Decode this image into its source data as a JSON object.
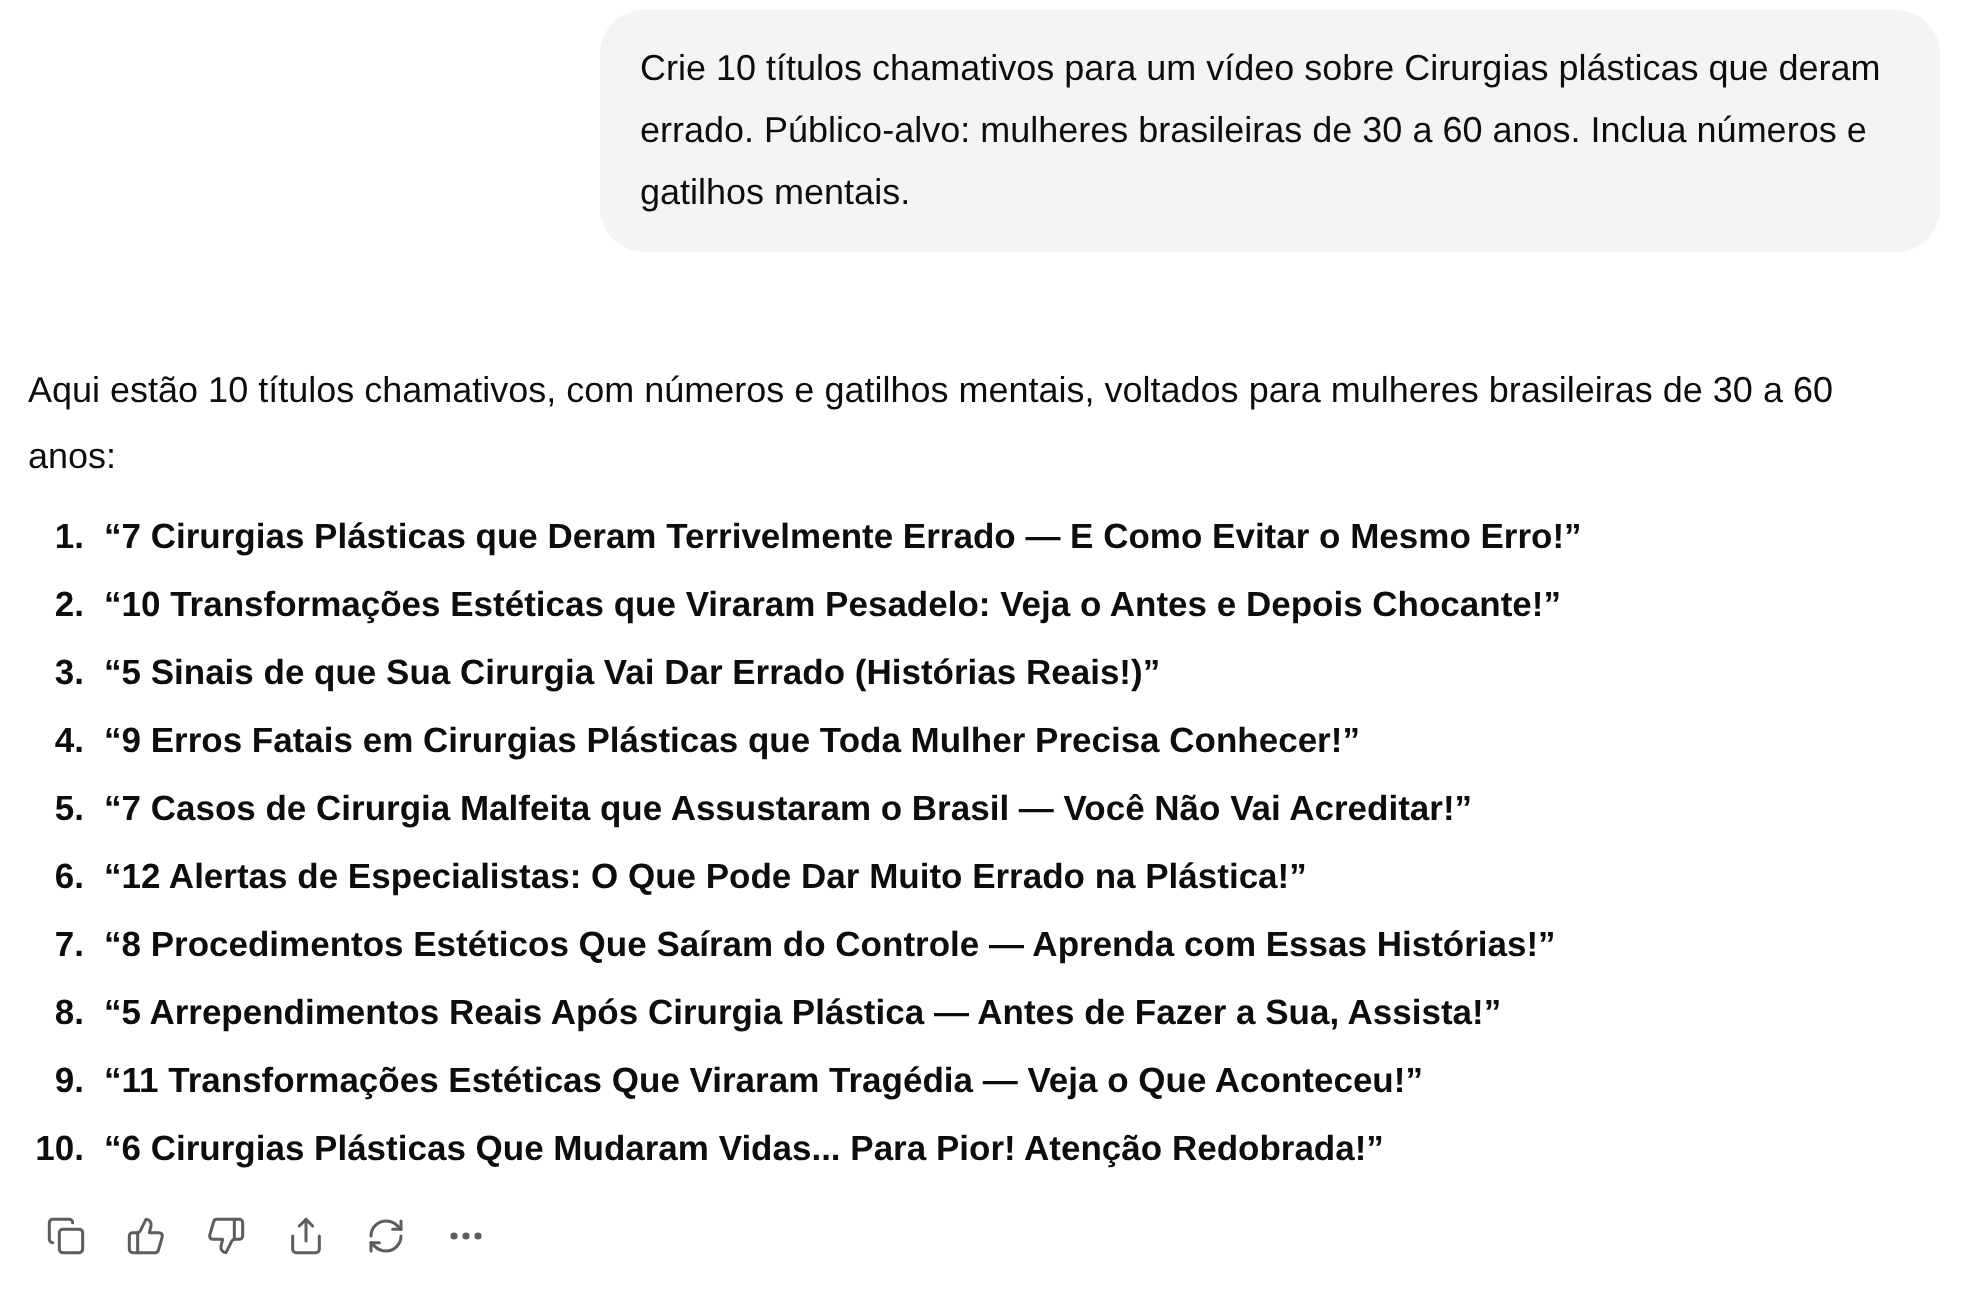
{
  "user_message": "Crie 10 títulos chamativos para um vídeo sobre Cirurgias plásticas que deram errado. Público-alvo: mulheres brasileiras de 30 a 60 anos. Inclua números e gatilhos mentais.",
  "response": {
    "intro": "Aqui estão 10 títulos chamativos, com números e gatilhos mentais, voltados para mulheres brasileiras de 30 a 60 anos:",
    "items": [
      {
        "number": "1.",
        "text": "“7 Cirurgias Plásticas que Deram Terrivelmente Errado — E Como Evitar o Mesmo Erro!”"
      },
      {
        "number": "2.",
        "text": "“10 Transformações Estéticas que Viraram Pesadelo: Veja o Antes e Depois Chocante!”"
      },
      {
        "number": "3.",
        "text": "“5 Sinais de que Sua Cirurgia Vai Dar Errado (Histórias Reais!)”"
      },
      {
        "number": "4.",
        "text": "“9 Erros Fatais em Cirurgias Plásticas que Toda Mulher Precisa Conhecer!”"
      },
      {
        "number": "5.",
        "text": "“7 Casos de Cirurgia Malfeita que Assustaram o Brasil — Você Não Vai Acreditar!”"
      },
      {
        "number": "6.",
        "text": "“12 Alertas de Especialistas: O Que Pode Dar Muito Errado na Plástica!”"
      },
      {
        "number": "7.",
        "text": "“8 Procedimentos Estéticos Que Saíram do Controle — Aprenda com Essas Histórias!”"
      },
      {
        "number": "8.",
        "text": "“5 Arrependimentos Reais Após Cirurgia Plástica — Antes de Fazer a Sua, Assista!”"
      },
      {
        "number": "9.",
        "text": "“11 Transformações Estéticas Que Viraram Tragédia — Veja o Que Aconteceu!”"
      },
      {
        "number": "10.",
        "text": "“6 Cirurgias Plásticas Que Mudaram Vidas... Para Pior! Atenção Redobrada!”"
      }
    ]
  },
  "actions": [
    {
      "kind": "copy"
    },
    {
      "kind": "like"
    },
    {
      "kind": "dislike"
    },
    {
      "kind": "share"
    },
    {
      "kind": "regenerate"
    },
    {
      "kind": "more"
    }
  ]
}
